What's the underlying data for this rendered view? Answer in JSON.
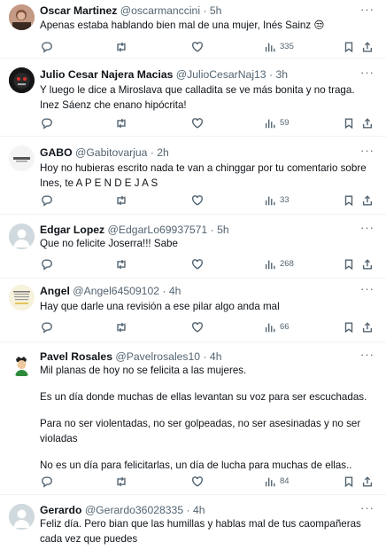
{
  "tweets": [
    {
      "name": "Oscar Martinez",
      "handle": "@oscarmanccini",
      "sep": "·",
      "time": "5h",
      "paragraphs": [
        "Apenas estaba hablando bien mal de una mujer, Inés Sainz 😒"
      ],
      "views": "335",
      "avatar": {
        "color": "#b07a64"
      }
    },
    {
      "name": "Julio Cesar Najera Macias",
      "handle": "@JulioCesarNaj13",
      "sep": "·",
      "time": "3h",
      "paragraphs": [
        "Y luego le dice a Miroslava que calladita se ve más bonita y no traga. Inez Sáenz che enano hipócrita!"
      ],
      "views": "59",
      "avatar": {
        "color": "#1a1a1a"
      }
    },
    {
      "name": "GABO",
      "handle": "@Gabitovarjua",
      "sep": "·",
      "time": "2h",
      "paragraphs": [
        "Hoy no hubieras escrito nada te van a chinggar por tu comentario sobre Ines, te A P E N D E J A S"
      ],
      "views": "33",
      "avatar": {
        "color": "#f2f2f2"
      }
    },
    {
      "name": "Edgar Lopez",
      "handle": "@EdgarLo69937571",
      "sep": "·",
      "time": "5h",
      "paragraphs": [
        "Que no felicite Joserra!!! Sabe"
      ],
      "views": "268",
      "avatar": {
        "color": "#cfd9de"
      }
    },
    {
      "name": "Angel",
      "handle": "@Angel64509102",
      "sep": "·",
      "time": "4h",
      "paragraphs": [
        "Hay que darle una revisión a ese pilar algo anda mal"
      ],
      "views": "66",
      "avatar": {
        "color": "#f6f0d8"
      }
    },
    {
      "name": "Pavel Rosales",
      "handle": "@Pavelrosales10",
      "sep": "·",
      "time": "4h",
      "paragraphs": [
        "Mil planas de hoy no se felicita a las mujeres.",
        "Es un día donde muchas de ellas levantan su voz para  ser escuchadas.",
        "Para no ser violentadas, no ser golpeadas, no ser asesinadas y no ser violadas",
        "No es un día para felicitarlas, un día de lucha para muchas de ellas.."
      ],
      "views": "84",
      "avatar": {
        "color": "#ffffff"
      }
    },
    {
      "name": "Gerardo",
      "handle": "@Gerardo36028335",
      "sep": "·",
      "time": "4h",
      "paragraphs": [
        "Feliz día. Pero bian que las humillas y hablas mal de tus caompañeras cada vez que puedes"
      ],
      "views": "",
      "avatar": {
        "color": "#cfd9de"
      }
    }
  ],
  "more_glyph": "···"
}
